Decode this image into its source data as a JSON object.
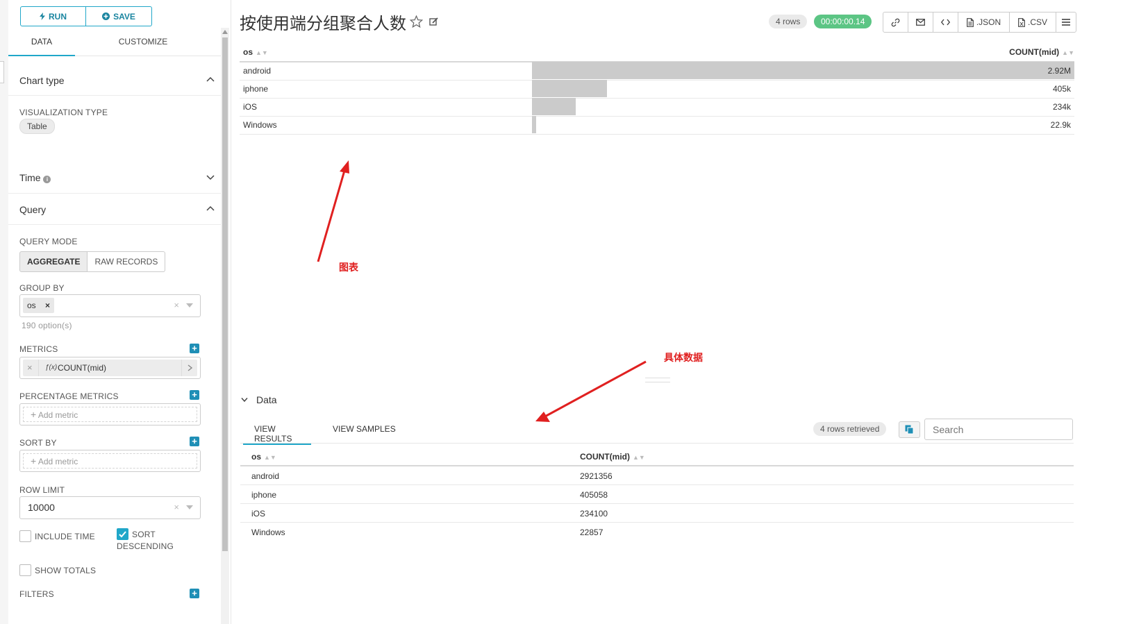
{
  "toolbar": {
    "run_label": "RUN",
    "save_label": "SAVE"
  },
  "control_tabs": [
    {
      "label": "DATA",
      "active": true
    },
    {
      "label": "CUSTOMIZE",
      "active": false
    }
  ],
  "sections": {
    "chart_type": "Chart type",
    "visualization_type_label": "VISUALIZATION TYPE",
    "visualization_type_value": "Table",
    "time": "Time",
    "query": "Query"
  },
  "query": {
    "mode_label": "QUERY MODE",
    "mode_options": [
      "AGGREGATE",
      "RAW RECORDS"
    ],
    "mode_selected": "AGGREGATE",
    "group_by_label": "GROUP BY",
    "group_by_tag": "os",
    "group_by_options_count": "190 option(s)",
    "metrics_label": "METRICS",
    "metric_fx": "ƒ(x)",
    "metric_value": "COUNT(mid)",
    "percentage_metrics_label": "PERCENTAGE METRICS",
    "add_metric_placeholder": "Add metric",
    "sort_by_label": "SORT BY",
    "row_limit_label": "ROW LIMIT",
    "row_limit_value": "10000",
    "include_time_label": "INCLUDE TIME",
    "include_time_checked": false,
    "sort_desc_label_1": "SORT",
    "sort_desc_label_2": "DESCENDING",
    "sort_desc_checked": true,
    "show_totals_label": "SHOW TOTALS",
    "show_totals_checked": false,
    "filters_label": "FILTERS"
  },
  "header": {
    "title": "按使用端分组聚合人数",
    "rows_badge": "4 rows",
    "time_badge": "00:00:00.14",
    "json_label": ".JSON",
    "csv_label": ".CSV"
  },
  "chart_data": {
    "type": "table",
    "columns": [
      "os",
      "COUNT(mid)"
    ],
    "rows": [
      {
        "os": "android",
        "value": 2921356,
        "display": "2.92M"
      },
      {
        "os": "iphone",
        "value": 405058,
        "display": "405k"
      },
      {
        "os": "iOS",
        "value": 234100,
        "display": "234k"
      },
      {
        "os": "Windows",
        "value": 22857,
        "display": "22.9k"
      }
    ],
    "max_value": 2921356
  },
  "annotations": {
    "chart": "图表",
    "data": "具体数据"
  },
  "data_panel": {
    "title": "Data",
    "tabs": [
      "VIEW RESULTS",
      "VIEW SAMPLES"
    ],
    "rows_retrieved": "4 rows retrieved",
    "search_placeholder": "Search",
    "columns": [
      "os",
      "COUNT(mid)"
    ],
    "rows": [
      [
        "android",
        "2921356"
      ],
      [
        "iphone",
        "405058"
      ],
      [
        "iOS",
        "234100"
      ],
      [
        "Windows",
        "22857"
      ]
    ]
  },
  "colors": {
    "accent": "#20a7c9",
    "success": "#5cc584",
    "annotation": "#e02020",
    "bar": "#cbcbcb"
  }
}
